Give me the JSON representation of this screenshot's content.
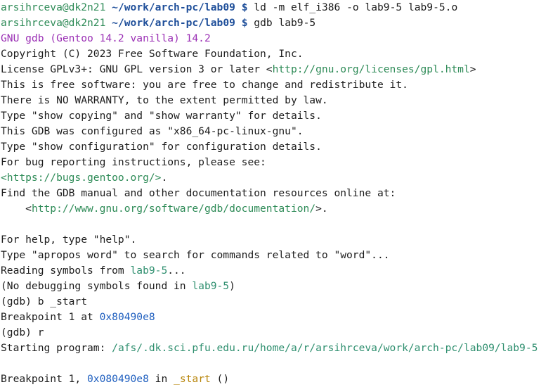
{
  "prompt": {
    "user_host": "arsihrceva@dk2n21",
    "path": "~/work/arch-pc/lab09",
    "symbol": "$"
  },
  "commands": {
    "ld": "ld -m elf_i386 -o lab9-5 lab9-5.o",
    "gdb": "gdb lab9-5"
  },
  "gdb_banner": {
    "version": "GNU gdb (Gentoo 14.2 vanilla) 14.2",
    "copyright": "Copyright (C) 2023 Free Software Foundation, Inc.",
    "license_pre": "License GPLv3+: GNU GPL version 3 or later <",
    "license_url": "http://gnu.org/licenses/gpl.html",
    "license_post": ">",
    "free": "This is free software: you are free to change and redistribute it.",
    "warranty": "There is NO WARRANTY, to the extent permitted by law.",
    "show_copying": "Type \"show copying\" and \"show warranty\" for details.",
    "configured": "This GDB was configured as \"x86_64-pc-linux-gnu\".",
    "show_config": "Type \"show configuration\" for configuration details.",
    "bug_reporting": "For bug reporting instructions, please see:",
    "bug_url": "<https://bugs.gentoo.org/>",
    "bug_url_post": ".",
    "find_manual": "Find the GDB manual and other documentation resources online at:",
    "doc_pre": "    <",
    "doc_url": "http://www.gnu.org/software/gdb/documentation/",
    "doc_post": ">."
  },
  "help_lines": {
    "help": "For help, type \"help\".",
    "apropos": "Type \"apropos word\" to search for commands related to \"word\"..."
  },
  "session": {
    "reading_pre": "Reading symbols from ",
    "reading_file": "lab9-5",
    "reading_post": "...",
    "nodebug_pre": "(No debugging symbols found in ",
    "nodebug_file": "lab9-5",
    "nodebug_post": ")",
    "cmd_break": "(gdb) b _start",
    "bp_set_pre": "Breakpoint 1 at ",
    "bp_set_addr": "0x80490e8",
    "cmd_run": "(gdb) r",
    "starting_pre": "Starting program: ",
    "starting_path": "/afs/.dk.sci.pfu.edu.ru/home/a/r/arsihrceva/work/arch-pc/lab09/lab9-5",
    "bp_hit_pre": "Breakpoint 1, ",
    "bp_hit_addr": "0x080490e8",
    "bp_hit_in": " in ",
    "bp_hit_func": "_start",
    "bp_hit_post": " ()"
  }
}
